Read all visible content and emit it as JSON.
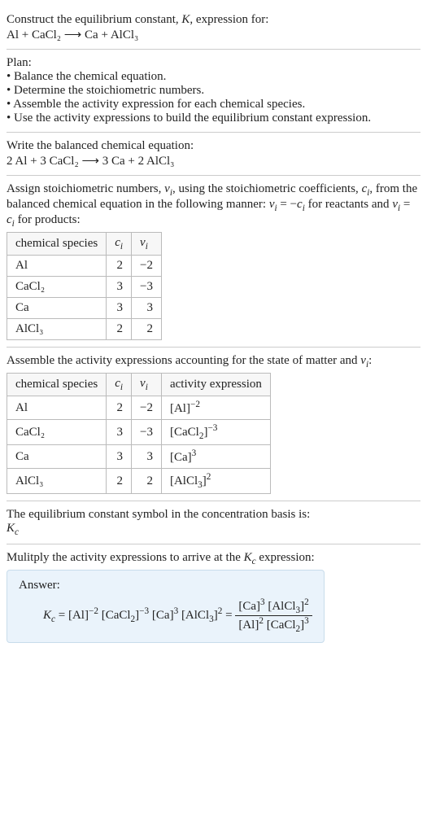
{
  "intro": {
    "line1": "Construct the equilibrium constant, K, expression for:",
    "reaction": "Al + CaCl₂ ⟶ Ca + AlCl₃"
  },
  "plan": {
    "heading": "Plan:",
    "items": [
      "• Balance the chemical equation.",
      "• Determine the stoichiometric numbers.",
      "• Assemble the activity expression for each chemical species.",
      "• Use the activity expressions to build the equilibrium constant expression."
    ]
  },
  "balanced": {
    "heading": "Write the balanced chemical equation:",
    "reaction": "2 Al + 3 CaCl₂ ⟶ 3 Ca + 2 AlCl₃"
  },
  "stoich": {
    "heading_a": "Assign stoichiometric numbers, νᵢ, using the stoichiometric coefficients, cᵢ, from the balanced chemical equation in the following manner: νᵢ = −cᵢ for reactants and νᵢ = cᵢ for products:",
    "col1": "chemical species",
    "col2": "cᵢ",
    "col3": "νᵢ",
    "rows": [
      {
        "sp": "Al",
        "c": "2",
        "v": "−2"
      },
      {
        "sp": "CaCl₂",
        "c": "3",
        "v": "−3"
      },
      {
        "sp": "Ca",
        "c": "3",
        "v": "3"
      },
      {
        "sp": "AlCl₃",
        "c": "2",
        "v": "2"
      }
    ]
  },
  "activity": {
    "heading": "Assemble the activity expressions accounting for the state of matter and νᵢ:",
    "col1": "chemical species",
    "col2": "cᵢ",
    "col3": "νᵢ",
    "col4": "activity expression",
    "rows": [
      {
        "sp": "Al",
        "c": "2",
        "v": "−2",
        "a": "[Al]⁻²"
      },
      {
        "sp": "CaCl₂",
        "c": "3",
        "v": "−3",
        "a": "[CaCl₂]⁻³"
      },
      {
        "sp": "Ca",
        "c": "3",
        "v": "3",
        "a": "[Ca]³"
      },
      {
        "sp": "AlCl₃",
        "c": "2",
        "v": "2",
        "a": "[AlCl₃]²"
      }
    ]
  },
  "symbol": {
    "heading": "The equilibrium constant symbol in the concentration basis is:",
    "value": "K_c"
  },
  "final": {
    "heading": "Mulitply the activity expressions to arrive at the K_c expression:",
    "answer_label": "Answer:",
    "lhs": "K_c = [Al]⁻² [CaCl₂]⁻³ [Ca]³ [AlCl₃]² =",
    "frac_num": "[Ca]³ [AlCl₃]²",
    "frac_den": "[Al]² [CaCl₂]³"
  }
}
